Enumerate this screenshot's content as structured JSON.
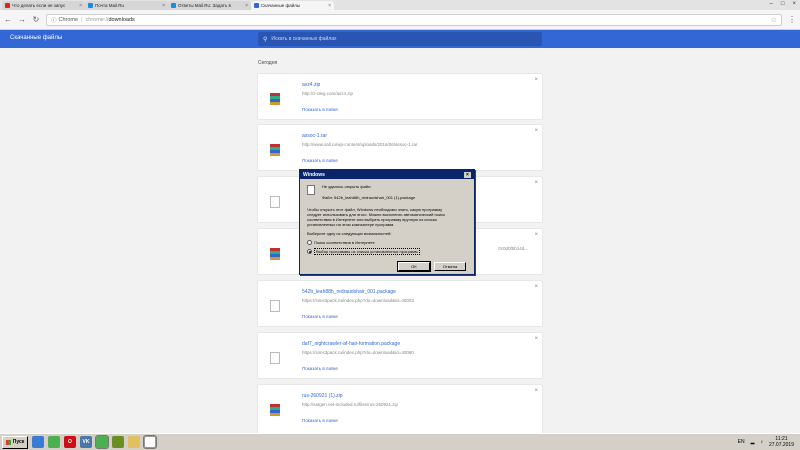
{
  "browser": {
    "tabs": [
      {
        "title": "Что делать если не запус",
        "fav_color": "#e62117",
        "active": false
      },
      {
        "title": "Почта Mail.Ru",
        "fav_color": "#168de2",
        "active": false
      },
      {
        "title": "Ответы Mail.Ru: Задать в",
        "fav_color": "#168de2",
        "active": false
      },
      {
        "title": "Скачанные файлы",
        "fav_color": "#3367d6",
        "active": true
      }
    ],
    "omnibox": {
      "chip": "Chrome",
      "scheme": "chrome://",
      "path": "downloads"
    },
    "nav_icons": {
      "back": "back-arrow-icon",
      "forward": "forward-arrow-icon",
      "reload": "reload-icon"
    }
  },
  "downloads_page": {
    "title": "Скачанные файлы",
    "search_placeholder": "Искать в скачанных файлах",
    "day_label": "Сегодня",
    "items": [
      {
        "name": "avz4.zip",
        "url": "http://z-oleg.com/avz4.zip",
        "action": "Показать в папке",
        "icon": "rar"
      },
      {
        "name": "assoc-1.rar",
        "url": "http://www.sall.ru/wp-content/uploads/2016/06/assoc-1.rar",
        "action": "Показать в папке",
        "icon": "rar"
      },
      {
        "name": "",
        "url": "",
        "action": "",
        "icon": "doc"
      },
      {
        "name": "",
        "url": "",
        "action": "",
        "more": "0c0d0f5b14d...",
        "icon": "rar"
      },
      {
        "name": "542b_leah88h_redraudshair_001.package",
        "url": "https://sims3pack.ru/index.php?do=download&id=40003",
        "action": "Показать в папке",
        "icon": "doc"
      },
      {
        "name": "daf7_nightcrawler-af-hair-formation.package",
        "url": "https://sims3pack.ru/index.php?do=download&id=40080",
        "action": "Показать в папке",
        "icon": "doc"
      },
      {
        "name": "rus-260921 (1).zip",
        "url": "http://satgen.net-included.ru/files/rus-260921.zip",
        "action": "Показать в папке",
        "icon": "rar"
      }
    ]
  },
  "dialog": {
    "title": "Windows",
    "heading": "Не удалось открыть файл:",
    "file_line": "Файл:   542b_leah88h_redraudshair_001 (1).package",
    "body": [
      "Чтобы открыть этот файл, Windows необходимо знать, какую программу",
      "следует использовать для этого. Можно выполнить автоматический поиск",
      "соответствия в Интернете или выбрать программу вручную из списка",
      "установленных на этом компьютере программ."
    ],
    "prompt": "Выберите одну из следующих возможностей:",
    "options": [
      {
        "label": "Поиск соответствия в Интернете",
        "selected": false
      },
      {
        "label": "Выбор программы из списка установленных программ",
        "selected": true
      }
    ],
    "ok_label": "OK",
    "cancel_label": "Отмена"
  },
  "taskbar": {
    "start_label": "Пуск",
    "apps": [
      {
        "icon": "media-player-icon",
        "color": "#3a7bd5",
        "glyph": ""
      },
      {
        "icon": "chrome-icon",
        "color": "#4caf50",
        "glyph": ""
      },
      {
        "icon": "opera-icon",
        "color": "#cc0f16",
        "glyph": "O"
      },
      {
        "icon": "vk-icon",
        "color": "#4a76a8",
        "glyph": "VK"
      },
      {
        "icon": "chrome-window-icon",
        "color": "#4caf50",
        "glyph": ""
      },
      {
        "icon": "game-icon",
        "color": "#6b8e23",
        "glyph": ""
      },
      {
        "icon": "documents-icon",
        "color": "#e0c060",
        "glyph": ""
      },
      {
        "icon": "unknown-file-icon",
        "color": "#ffffff",
        "glyph": ""
      }
    ],
    "lang": "EN",
    "time": "11:21",
    "date": "27.07.2019"
  }
}
